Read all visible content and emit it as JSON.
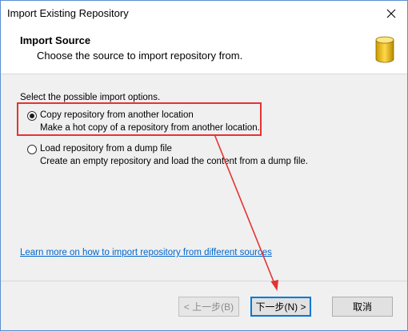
{
  "window": {
    "title": "Import Existing Repository"
  },
  "header": {
    "title": "Import Source",
    "subtitle": "Choose the source to import repository from."
  },
  "content": {
    "intro": "Select the possible import options.",
    "options": [
      {
        "label": "Copy repository from another location",
        "description": "Make a hot copy of a repository from another location.",
        "selected": true
      },
      {
        "label": "Load repository from a dump file",
        "description": "Create an empty repository and load the content from a dump file.",
        "selected": false
      }
    ],
    "learn_more_link": "Learn more on how to import repository from different sources"
  },
  "footer": {
    "back_label": "< 上一步(B)",
    "next_label": "下一步(N) >",
    "cancel_label": "取消"
  },
  "colors": {
    "annotation": "#e53333",
    "link": "#0066cc",
    "default_button_border": "#0078d7"
  }
}
